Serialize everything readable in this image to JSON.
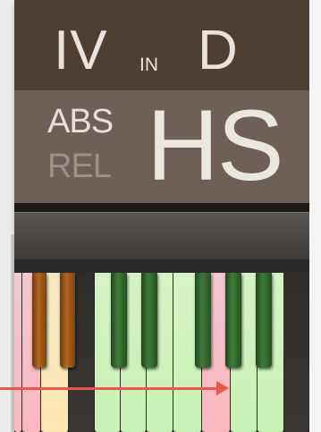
{
  "readout": {
    "degree": "IV",
    "in_word": "IN",
    "key": "D"
  },
  "mode": {
    "abs": "ABS",
    "rel": "REL",
    "scale": "HS"
  },
  "colors": {
    "in_scale": "#c8f2b5",
    "root": "#fbb6bf",
    "outside_scale": "#fde7b1",
    "annotation_arrow": "#e8584d"
  },
  "keyboard": {
    "highlighted_root_key": "white-key-9"
  }
}
